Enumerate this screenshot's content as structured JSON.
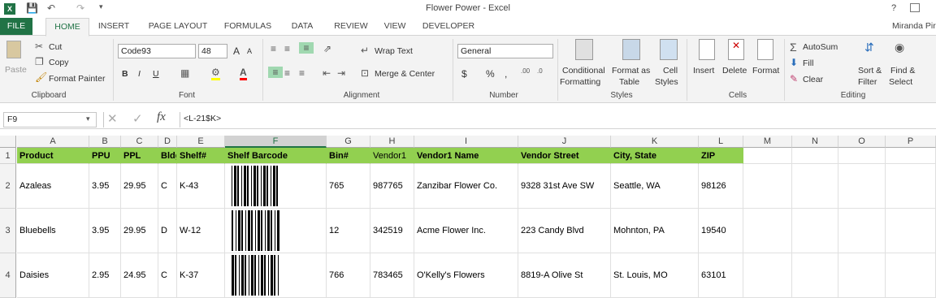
{
  "window": {
    "title": "Flower Power - Excel",
    "user": "Miranda Pir",
    "help": "?"
  },
  "tabs": [
    "FILE",
    "HOME",
    "INSERT",
    "PAGE LAYOUT",
    "FORMULAS",
    "DATA",
    "REVIEW",
    "VIEW",
    "DEVELOPER"
  ],
  "ribbon": {
    "clipboard": {
      "paste": "Paste",
      "cut": "Cut",
      "copy": "Copy",
      "format_painter": "Format Painter",
      "label": "Clipboard"
    },
    "font": {
      "name": "Code93",
      "size": "48",
      "bold": "B",
      "italic": "I",
      "underline": "U",
      "grow": "A",
      "shrink": "A",
      "label": "Font"
    },
    "alignment": {
      "wrap": "Wrap Text",
      "merge": "Merge & Center",
      "label": "Alignment"
    },
    "number": {
      "format": "General",
      "currency": "$",
      "percent": "%",
      "comma": ",",
      "label": "Number"
    },
    "styles": {
      "conditional": "Conditional",
      "conditional2": "Formatting",
      "format_table": "Format as",
      "format_table2": "Table",
      "cell_styles": "Cell",
      "cell_styles2": "Styles",
      "label": "Styles"
    },
    "cells": {
      "insert": "Insert",
      "delete": "Delete",
      "format": "Format",
      "label": "Cells"
    },
    "editing": {
      "autosum": "AutoSum",
      "fill": "Fill",
      "clear": "Clear",
      "sort": "Sort &",
      "sort2": "Filter",
      "find": "Find &",
      "find2": "Select",
      "label": "Editing"
    }
  },
  "formula_bar": {
    "name_box": "F9",
    "formula": "<L-21$K>"
  },
  "columns": [
    "A",
    "B",
    "C",
    "D",
    "E",
    "F",
    "G",
    "H",
    "I",
    "J",
    "K",
    "L",
    "M",
    "N",
    "O",
    "P"
  ],
  "selected_column": "F",
  "header_row": [
    "Product",
    "PPU",
    "PPL",
    "Bldg",
    "Shelf#",
    "Shelf Barcode",
    "Bin#",
    "Vendor1",
    "Vendor1 Name",
    "Vendor Street",
    "City, State",
    "ZIP"
  ],
  "rows": [
    {
      "num": "1"
    },
    {
      "num": "2",
      "cells": [
        "Azaleas",
        "3.95",
        "29.95",
        "C",
        "K-43",
        "",
        "765",
        "987765",
        "Zanzibar Flower Co.",
        "9328 31st Ave SW",
        "Seattle, WA",
        "98126"
      ]
    },
    {
      "num": "3",
      "cells": [
        "Bluebells",
        "3.95",
        "29.95",
        "D",
        "W-12",
        "",
        "12",
        "342519",
        "Acme Flower Inc.",
        "223 Candy Blvd",
        "Mohnton, PA",
        "19540"
      ]
    },
    {
      "num": "4",
      "cells": [
        "Daisies",
        "2.95",
        "24.95",
        "C",
        "K-37",
        "",
        "766",
        "783465",
        "O'Kelly's Flowers",
        "8819-A Olive St",
        "St. Louis, MO",
        "63101"
      ]
    }
  ],
  "colors": {
    "accent": "#217346",
    "header_fill": "#92d050"
  }
}
